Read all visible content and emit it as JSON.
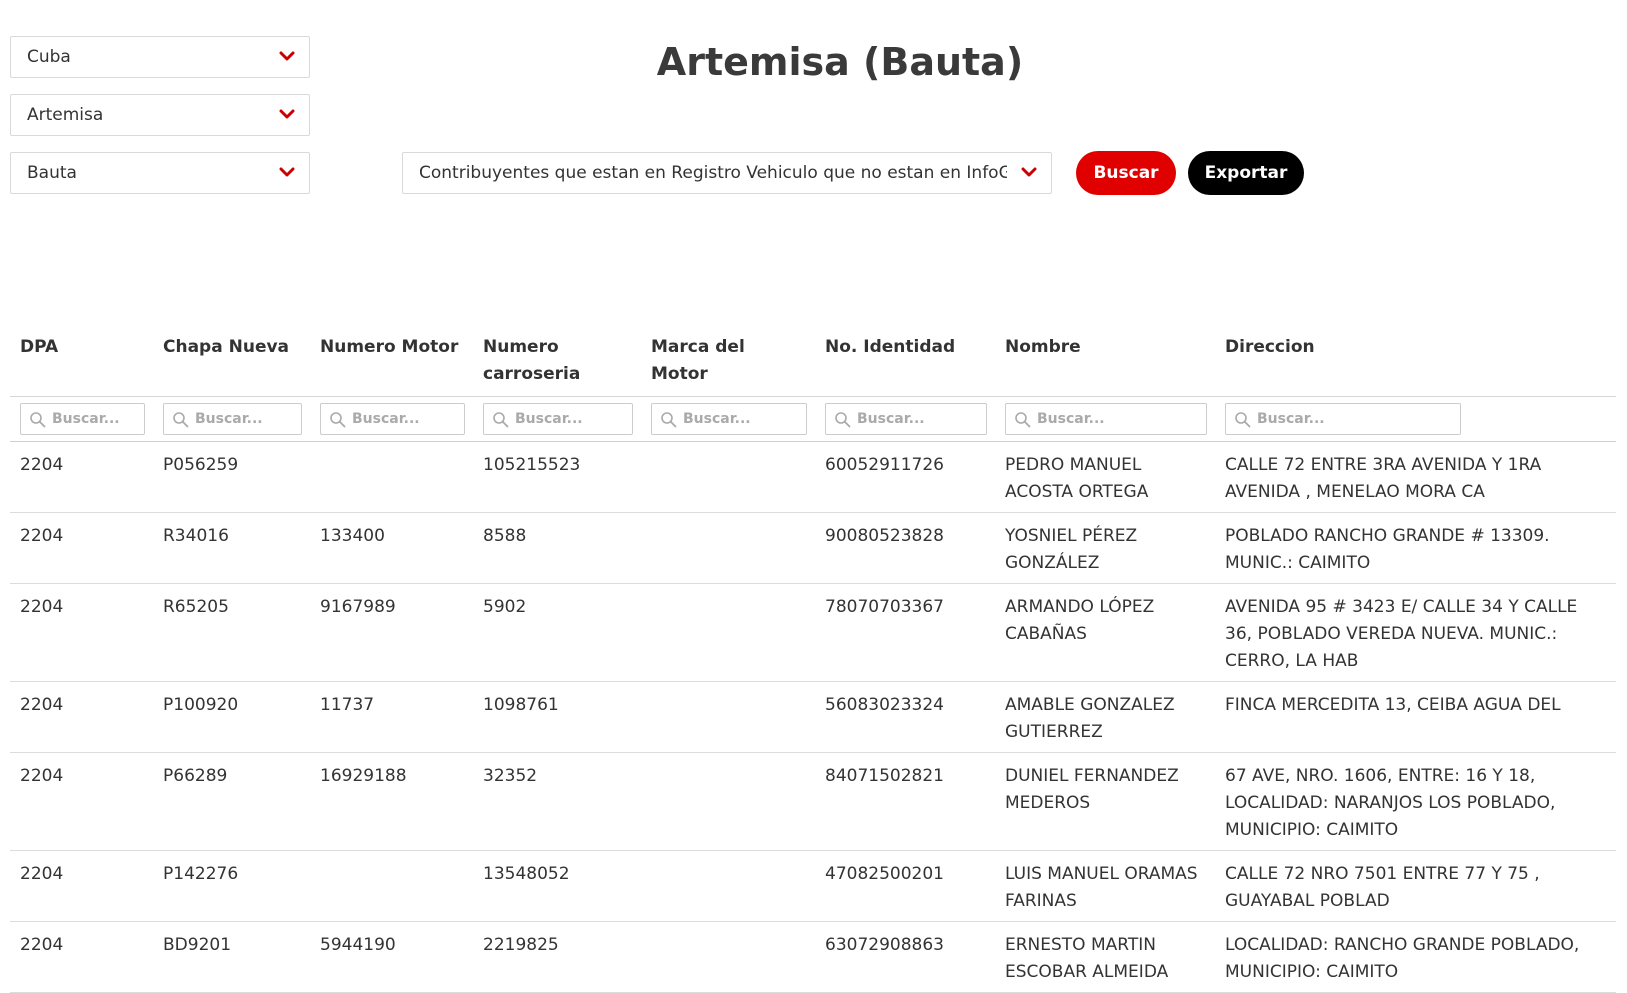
{
  "filters": {
    "country": "Cuba",
    "province": "Artemisa",
    "municipality": "Bauta",
    "report": "Contribuyentes que estan en Registro Vehiculo que no estan en InfoGesti"
  },
  "title": "Artemisa (Bauta)",
  "buttons": {
    "search": "Buscar",
    "export": "Exportar"
  },
  "colors": {
    "search_button": "#e00000",
    "export_button": "#000000",
    "chevron": "#cc0000"
  },
  "table": {
    "columns": [
      "DPA",
      "Chapa Nueva",
      "Numero Motor",
      "Numero carroseria",
      "Marca del Motor",
      "No. Identidad",
      "Nombre",
      "Direccion"
    ],
    "filter_placeholder": "Buscar...",
    "rows": [
      [
        "2204",
        "P056259",
        "",
        "105215523",
        "",
        "60052911726",
        "PEDRO MANUEL ACOSTA ORTEGA",
        "CALLE 72 ENTRE 3RA AVENIDA Y 1RA AVENIDA , MENELAO MORA CA"
      ],
      [
        "2204",
        "R34016",
        "133400",
        "8588",
        "",
        "90080523828",
        "YOSNIEL PÉREZ GONZÁLEZ",
        "POBLADO RANCHO GRANDE # 13309. MUNIC.: CAIMITO"
      ],
      [
        "2204",
        "R65205",
        "9167989",
        "5902",
        "",
        "78070703367",
        "ARMANDO LÓPEZ CABAÑAS",
        "AVENIDA 95 # 3423 E/ CALLE 34 Y CALLE 36, POBLADO VEREDA NUEVA. MUNIC.: CERRO, LA HAB"
      ],
      [
        "2204",
        "P100920",
        "11737",
        "1098761",
        "",
        "56083023324",
        "AMABLE GONZALEZ GUTIERREZ",
        "FINCA MERCEDITA 13, CEIBA AGUA DEL"
      ],
      [
        "2204",
        "P66289",
        "16929188",
        "32352",
        "",
        "84071502821",
        "DUNIEL FERNANDEZ MEDEROS",
        "67 AVE, NRO. 1606, ENTRE: 16 Y 18, LOCALIDAD: NARANJOS LOS POBLADO, MUNICIPIO: CAIMITO"
      ],
      [
        "2204",
        "P142276",
        "",
        "13548052",
        "",
        "47082500201",
        "LUIS MANUEL ORAMAS FARINAS",
        "CALLE 72 NRO 7501 ENTRE 77 Y 75 , GUAYABAL POBLAD"
      ],
      [
        "2204",
        "BD9201",
        "5944190",
        "2219825",
        "",
        "63072908863",
        "ERNESTO MARTIN ESCOBAR ALMEIDA",
        "LOCALIDAD: RANCHO GRANDE POBLADO, MUNICIPIO: CAIMITO"
      ]
    ]
  }
}
